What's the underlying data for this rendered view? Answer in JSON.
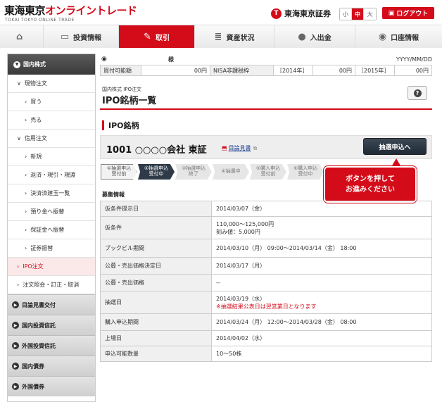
{
  "header": {
    "logo_jp": "東海東京",
    "logo_kana": "オンライントレード",
    "logo_sub": "TOKAI TOKYO ONLINE TRADE",
    "brand_mark": "T",
    "brand_name": "東海東京証券",
    "font_sizes": [
      "小",
      "中",
      "大"
    ],
    "logout_label": "ログアウト"
  },
  "nav": {
    "items": [
      {
        "label": "",
        "icon": "home-icon"
      },
      {
        "label": "投資情報",
        "icon": "monitor-icon"
      },
      {
        "label": "取引",
        "icon": "handshake-icon"
      },
      {
        "label": "資産状況",
        "icon": "coins-icon"
      },
      {
        "label": "入出金",
        "icon": "piggybank-icon"
      },
      {
        "label": "口座情報",
        "icon": "user-icon"
      }
    ]
  },
  "sidebar": {
    "head": "国内株式",
    "genbutsu": "現物注文",
    "genbutsu_items": [
      "買う",
      "売る"
    ],
    "shinyo": "信用注文",
    "shinyo_items": [
      "新規",
      "返済・現引・現渡",
      "決済済建玉一覧",
      "預り金へ振替",
      "保証金へ振替",
      "証券振替"
    ],
    "ipo": "IPO注文",
    "inquiry": "注文照会・訂正・取消",
    "sections": [
      "目論見書交付",
      "国内投資信託",
      "外国投資信託",
      "国内債券",
      "外国債券"
    ]
  },
  "account": {
    "name_suffix": "様",
    "date": "YYYY/MM/DD"
  },
  "balance": {
    "buy_label": "買付可能額",
    "buy_value": "00円",
    "nisa_label": "NISA非課税枠",
    "y2014": "［2014年］",
    "v2014": "00円",
    "y2015": "［2015年］",
    "v2015": "00円"
  },
  "page": {
    "breadcrumb": "国内株式 IPO注文",
    "title": "IPO銘柄一覧",
    "section_title": "IPO銘柄"
  },
  "stock": {
    "name": "1001 ○○○○会社 東証",
    "prospectus": "目論見書",
    "apply_label": "抽選申込へ"
  },
  "steps": [
    {
      "l1": "①抽選申込",
      "l2": "受付前"
    },
    {
      "l1": "②抽選申込",
      "l2": "受付中"
    },
    {
      "l1": "③抽選申込",
      "l2": "終了"
    },
    {
      "l1": "④抽選中",
      "l2": ""
    },
    {
      "l1": "⑤購入申込",
      "l2": "受付前"
    },
    {
      "l1": "⑥購入申込",
      "l2": "受付中"
    }
  ],
  "callout": {
    "line1": "ボタンを押して",
    "line2": "お進みください"
  },
  "info": {
    "title": "募集情報",
    "rows": [
      {
        "k": "仮条件提示日",
        "v": "2014/03/07（金）"
      },
      {
        "k": "仮条件",
        "v": "110,000～125,000円",
        "v2": "刻み値：5,000円"
      },
      {
        "k": "ブックビル期間",
        "v": "2014/03/10（月） 09:00～2014/03/14（金） 18:00"
      },
      {
        "k": "公募・売出価格決定日",
        "v": "2014/03/17（月）"
      },
      {
        "k": "公募・売出価格",
        "v": "--"
      },
      {
        "k": "抽選日",
        "v": "2014/03/19（水）",
        "note": "※抽選結果公表日は翌営業日となります"
      },
      {
        "k": "購入申込期間",
        "v": "2014/03/24（月） 12:00～2014/03/28（金） 08:00"
      },
      {
        "k": "上場日",
        "v": "2014/04/02（水）"
      },
      {
        "k": "申込可能数量",
        "v": "10～50株"
      }
    ]
  },
  "colors": {
    "accent": "#d40c1a",
    "dark_button": "#2e3a47"
  }
}
